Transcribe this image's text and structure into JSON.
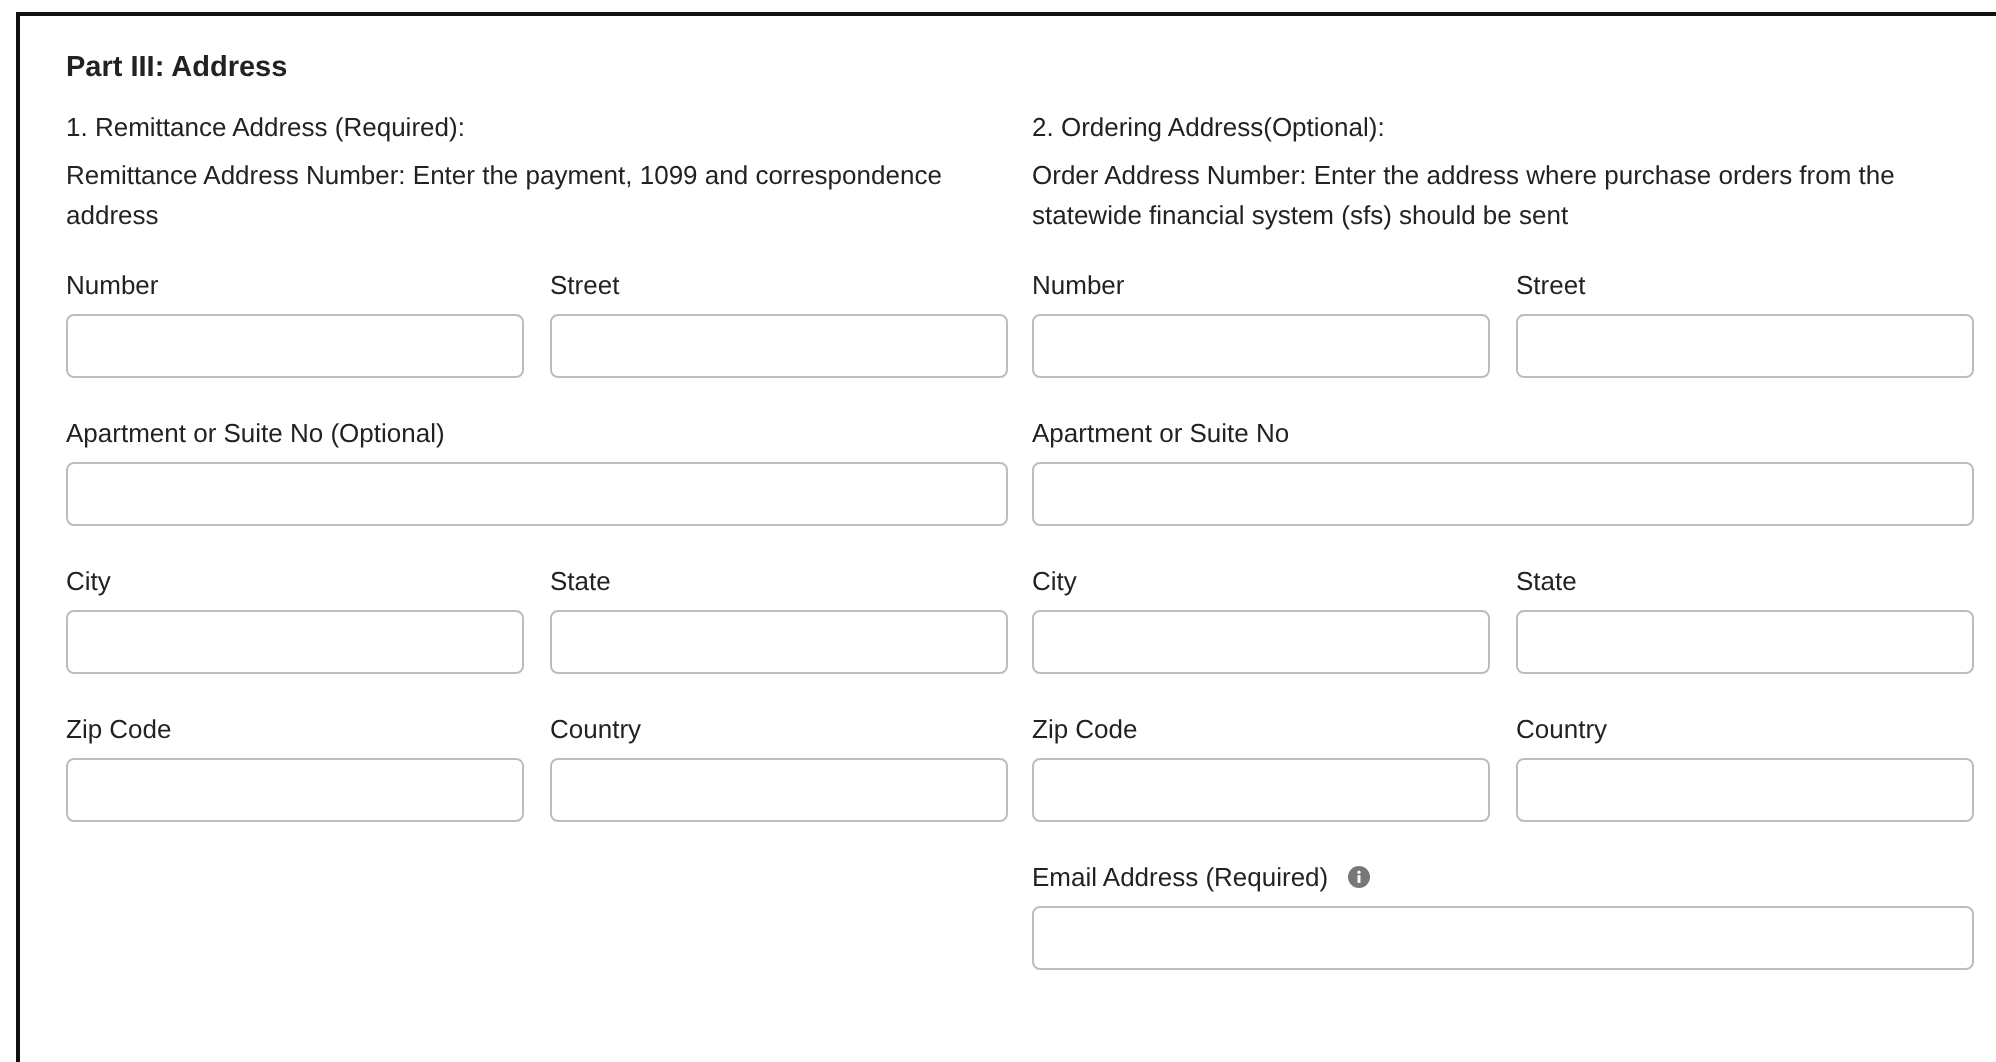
{
  "heading": "Part III: Address",
  "sections": [
    {
      "title": "1. Remittance Address (Required):",
      "description": "Remittance Address Number: Enter the payment, 1099 and correspondence address",
      "rows": [
        [
          {
            "label": "Number",
            "kind": "half"
          },
          {
            "label": "Street",
            "kind": "half"
          }
        ],
        [
          {
            "label": "Apartment or Suite No (Optional)",
            "kind": "full"
          }
        ],
        [
          {
            "label": "City",
            "kind": "half"
          },
          {
            "label": "State",
            "kind": "half"
          }
        ],
        [
          {
            "label": "Zip Code",
            "kind": "half"
          },
          {
            "label": "Country",
            "kind": "half"
          }
        ]
      ]
    },
    {
      "title": "2. Ordering Address(Optional):",
      "description": "Order Address Number: Enter the address where purchase orders from the statewide financial system (sfs) should be sent",
      "rows": [
        [
          {
            "label": "Number",
            "kind": "half"
          },
          {
            "label": "Street",
            "kind": "half"
          }
        ],
        [
          {
            "label": "Apartment or Suite No",
            "kind": "full"
          }
        ],
        [
          {
            "label": "City",
            "kind": "half"
          },
          {
            "label": "State",
            "kind": "half"
          }
        ],
        [
          {
            "label": "Zip Code",
            "kind": "half"
          },
          {
            "label": "Country",
            "kind": "half"
          }
        ],
        [
          {
            "label": "Email Address (Required)",
            "kind": "full",
            "info": true
          }
        ]
      ]
    }
  ]
}
